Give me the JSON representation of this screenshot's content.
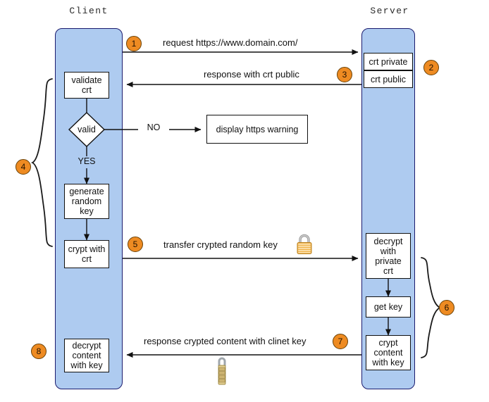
{
  "diagram": {
    "title_client": "Client",
    "title_server": "Server",
    "colors": {
      "lane_fill": "#aecbf0",
      "lane_border": "#1b1b6e",
      "badge_fill": "#ee8b22",
      "badge_border": "#6a4208",
      "box_border": "#111111",
      "line": "#111111",
      "background": "#ffffff"
    }
  },
  "client": {
    "lane_label": "Client",
    "boxes": [
      {
        "id": "validate-crt",
        "label": "validate\ncrt"
      },
      {
        "id": "generate-random-key",
        "label": "generate\nrandom\nkey"
      },
      {
        "id": "crypt-with-crt",
        "label": "crypt with\ncrt"
      },
      {
        "id": "decrypt-content-with-key",
        "label": "decrypt\ncontent\nwith key"
      }
    ],
    "decision": {
      "id": "valid-decision",
      "label": "valid"
    },
    "branch_no": "NO",
    "branch_yes": "YES",
    "warning_box": "display https warning"
  },
  "server": {
    "lane_label": "Server",
    "boxes": [
      {
        "id": "crt-private",
        "label": "crt private"
      },
      {
        "id": "crt-public",
        "label": "crt public"
      },
      {
        "id": "decrypt-with-private-crt",
        "label": "decrypt\nwith\nprivate\ncrt"
      },
      {
        "id": "get-key",
        "label": "get key"
      },
      {
        "id": "crypt-content-with-key",
        "label": "crypt\ncontent\nwith key"
      }
    ]
  },
  "messages": [
    {
      "id": "m1",
      "number": "1",
      "text": "request https://www.domain.com/",
      "direction": "client-to-server"
    },
    {
      "id": "m3",
      "number": "3",
      "text": "response with crt public",
      "direction": "server-to-client"
    },
    {
      "id": "m5",
      "number": "5",
      "text": "transfer crypted random key",
      "direction": "client-to-server"
    },
    {
      "id": "m7",
      "number": "7",
      "text": "response crypted content with clinet key",
      "direction": "server-to-client"
    }
  ],
  "badges": [
    {
      "id": "badge-1",
      "number": "1"
    },
    {
      "id": "badge-2",
      "number": "2"
    },
    {
      "id": "badge-3",
      "number": "3"
    },
    {
      "id": "badge-4",
      "number": "4"
    },
    {
      "id": "badge-5",
      "number": "5"
    },
    {
      "id": "badge-6",
      "number": "6"
    },
    {
      "id": "badge-7",
      "number": "7"
    },
    {
      "id": "badge-8",
      "number": "8"
    }
  ],
  "icons": {
    "padlock_closed": "padlock-icon",
    "padlock_combination": "combination-padlock-icon"
  }
}
